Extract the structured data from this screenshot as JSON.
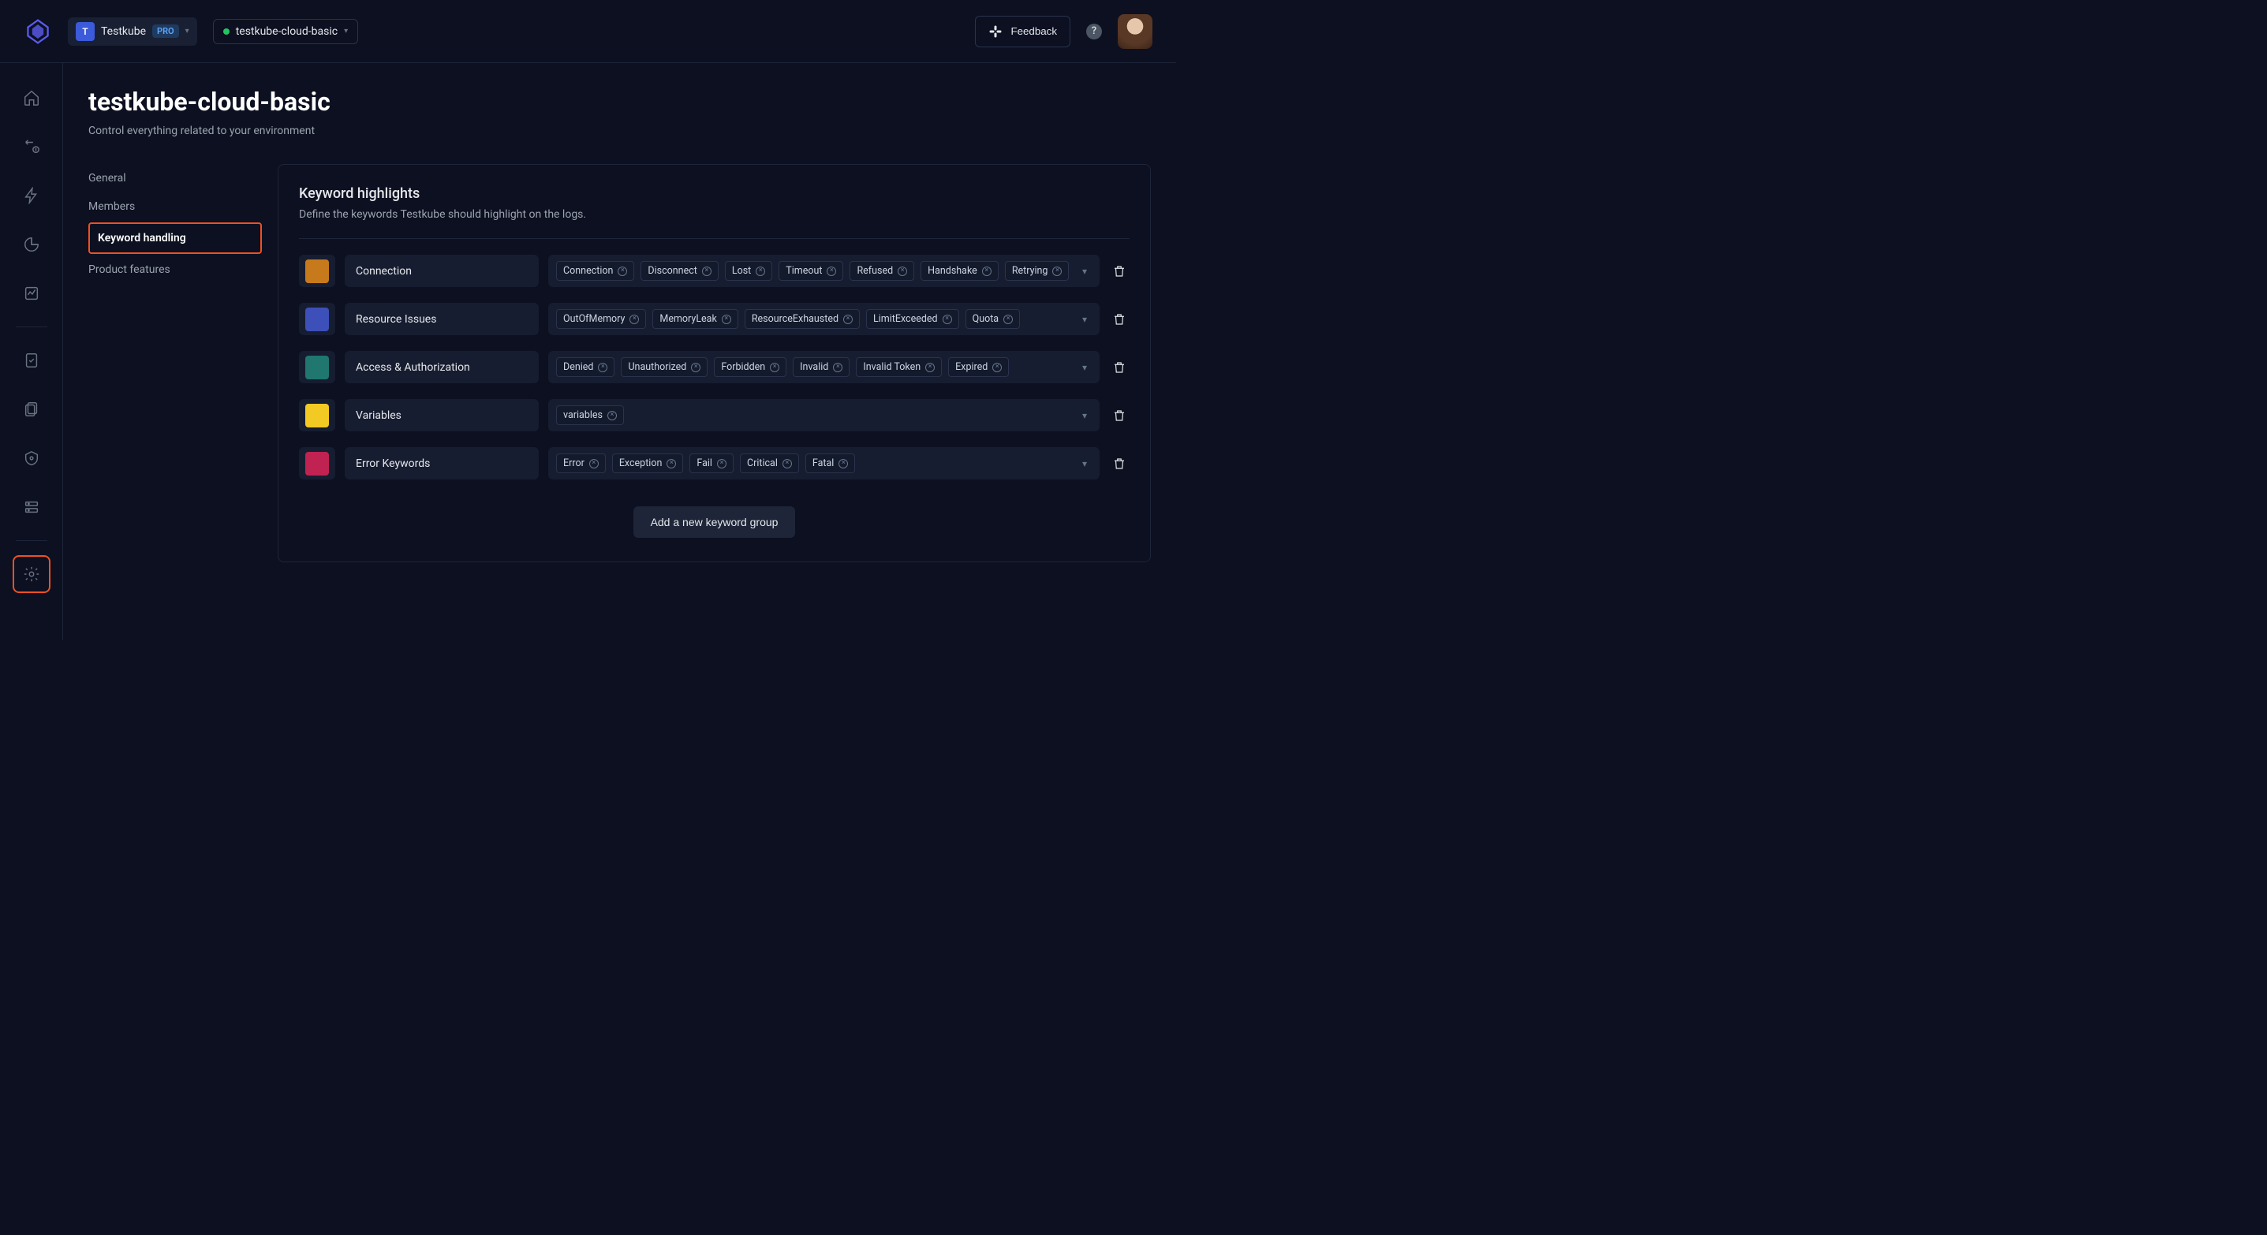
{
  "header": {
    "org_initial": "T",
    "org_name": "Testkube",
    "plan": "PRO",
    "env_name": "testkube-cloud-basic",
    "feedback_label": "Feedback",
    "help_symbol": "?"
  },
  "page": {
    "title": "testkube-cloud-basic",
    "subtitle": "Control everything related to your environment"
  },
  "settings_nav": [
    "General",
    "Members",
    "Keyword handling",
    "Product features"
  ],
  "panel": {
    "title": "Keyword highlights",
    "description": "Define the keywords Testkube should highlight on the logs.",
    "add_label": "Add a new keyword group"
  },
  "groups": [
    {
      "color": "#c77a1c",
      "name": "Connection",
      "tags": [
        "Connection",
        "Disconnect",
        "Lost",
        "Timeout",
        "Refused",
        "Handshake",
        "Retrying"
      ]
    },
    {
      "color": "#3d4fb8",
      "name": "Resource Issues",
      "tags": [
        "OutOfMemory",
        "MemoryLeak",
        "ResourceExhausted",
        "LimitExceeded",
        "Quota"
      ]
    },
    {
      "color": "#1f776f",
      "name": "Access & Authorization",
      "tags": [
        "Denied",
        "Unauthorized",
        "Forbidden",
        "Invalid",
        "Invalid Token",
        "Expired"
      ]
    },
    {
      "color": "#f3c923",
      "name": "Variables",
      "tags": [
        "variables"
      ]
    },
    {
      "color": "#c02251",
      "name": "Error Keywords",
      "tags": [
        "Error",
        "Exception",
        "Fail",
        "Critical",
        "Fatal"
      ]
    }
  ]
}
